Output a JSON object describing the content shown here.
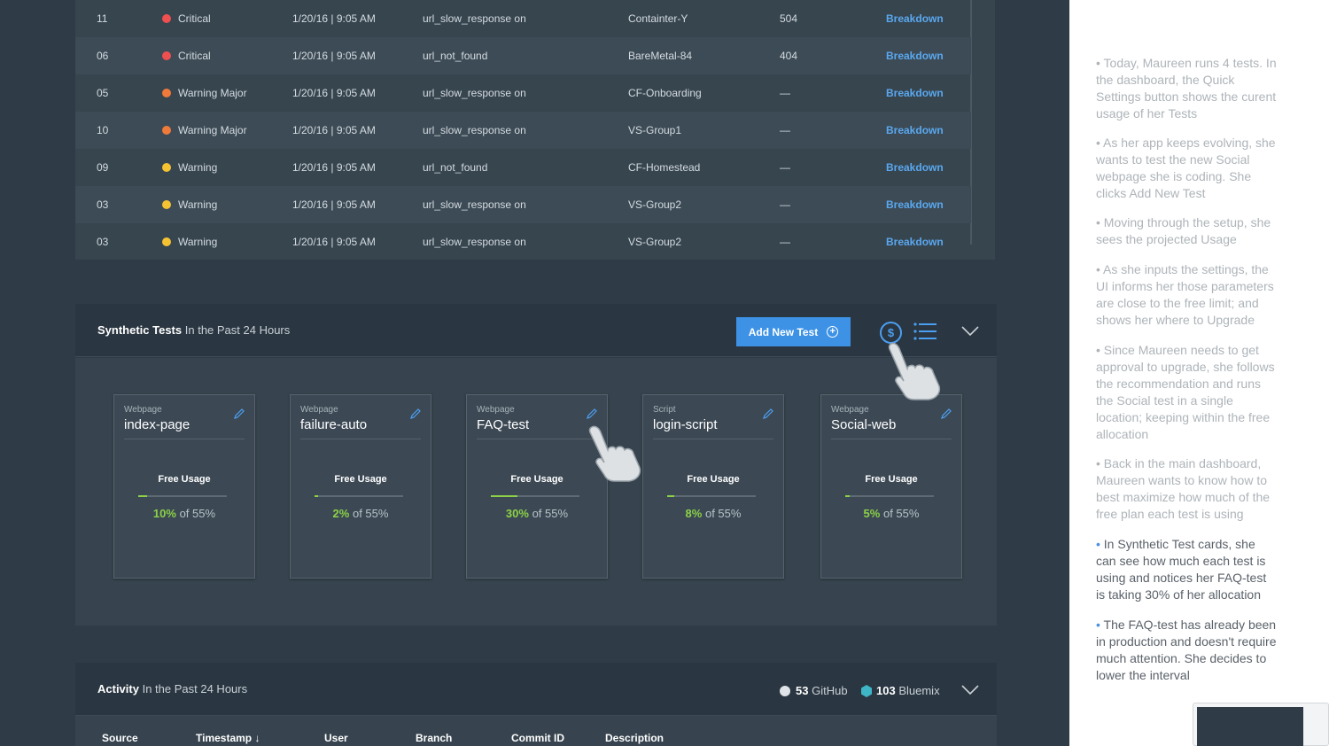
{
  "alerts": [
    {
      "id": "11",
      "severity": "Critical",
      "color": "#ef4f4f",
      "time": "1/20/16 | 9:05 AM",
      "message": "url_slow_response on",
      "resource": "Containter-Y",
      "code": "504",
      "action": "Breakdown"
    },
    {
      "id": "06",
      "severity": "Critical",
      "color": "#ef4f4f",
      "time": "1/20/16 | 9:05 AM",
      "message": "url_not_found",
      "resource": "BareMetal-84",
      "code": "404",
      "action": "Breakdown"
    },
    {
      "id": "05",
      "severity": "Warning Major",
      "color": "#f07a3a",
      "time": "1/20/16 | 9:05 AM",
      "message": "url_slow_response on",
      "resource": "CF-Onboarding",
      "code": "—",
      "action": "Breakdown"
    },
    {
      "id": "10",
      "severity": "Warning Major",
      "color": "#f07a3a",
      "time": "1/20/16 | 9:05 AM",
      "message": "url_slow_response on",
      "resource": "VS-Group1",
      "code": "—",
      "action": "Breakdown"
    },
    {
      "id": "09",
      "severity": "Warning",
      "color": "#f5c332",
      "time": "1/20/16 | 9:05 AM",
      "message": "url_not_found",
      "resource": "CF-Homestead",
      "code": "—",
      "action": "Breakdown"
    },
    {
      "id": "03",
      "severity": "Warning",
      "color": "#f5c332",
      "time": "1/20/16 | 9:05 AM",
      "message": "url_slow_response on",
      "resource": "VS-Group2",
      "code": "—",
      "action": "Breakdown"
    },
    {
      "id": "03",
      "severity": "Warning",
      "color": "#f5c332",
      "time": "1/20/16 | 9:05 AM",
      "message": "url_slow_response on",
      "resource": "VS-Group2",
      "code": "—",
      "action": "Breakdown"
    }
  ],
  "synthetic": {
    "title": "Synthetic Tests",
    "subtitle": "In the Past 24 Hours",
    "add_label": "Add New Test",
    "add_icon": "+",
    "dollar_icon": "$",
    "cards": [
      {
        "type": "Webpage",
        "name": "index-page",
        "usage_label": "Free Usage",
        "pct": "10%",
        "of": "of 55%",
        "fraction": 0.1
      },
      {
        "type": "Webpage",
        "name": "failure-auto",
        "usage_label": "Free Usage",
        "pct": "2%",
        "of": "of 55%",
        "fraction": 0.02
      },
      {
        "type": "Webpage",
        "name": "FAQ-test",
        "usage_label": "Free Usage",
        "pct": "30%",
        "of": "of 55%",
        "fraction": 0.3
      },
      {
        "type": "Script",
        "name": "login-script",
        "usage_label": "Free Usage",
        "pct": "8%",
        "of": "of 55%",
        "fraction": 0.08
      },
      {
        "type": "Webpage",
        "name": "Social-web",
        "usage_label": "Free Usage",
        "pct": "5%",
        "of": "of 55%",
        "fraction": 0.05
      }
    ]
  },
  "activity": {
    "title": "Activity",
    "subtitle": "In the Past 24 Hours",
    "github_count": "53",
    "github_label": "GitHub",
    "bluemix_count": "103",
    "bluemix_label": "Bluemix",
    "columns": [
      "Source",
      "Timestamp ↓",
      "User",
      "Branch",
      "Commit ID",
      "Description"
    ]
  },
  "notes": [
    {
      "bullet": "•",
      "text": "Today, Maureen runs 4 tests. In the dashboard, the Quick Settings button shows the curent usage of her Tests",
      "active": false
    },
    {
      "bullet": "•",
      "text": "As her app keeps evolving, she wants to test the new Social webpage she is coding. She clicks Add New Test",
      "active": false
    },
    {
      "bullet": "•",
      "text": "Moving through the setup, she sees the projected Usage",
      "active": false
    },
    {
      "bullet": "•",
      "text": "As she inputs the settings, the UI informs her those parameters are close to the free limit; and shows her where to Upgrade",
      "active": false
    },
    {
      "bullet": "•",
      "text": "Since Maureen needs to get approval to upgrade, she follows the recommendation and runs the Social test in a single location; keeping within the free allocation",
      "active": false
    },
    {
      "bullet": "•",
      "text": "Back in the main dashboard, Maureen wants to know how to best maximize how much of the free plan each test is using",
      "active": false
    },
    {
      "bullet": "•",
      "text": "In Synthetic Test cards, she can see how much each test is using and notices her FAQ-test is taking 30% of her allocation",
      "active": true
    },
    {
      "bullet": "•",
      "text": "The FAQ-test has already been in production and doesn't require much attention. She decides to lower the interval",
      "active": true
    }
  ]
}
